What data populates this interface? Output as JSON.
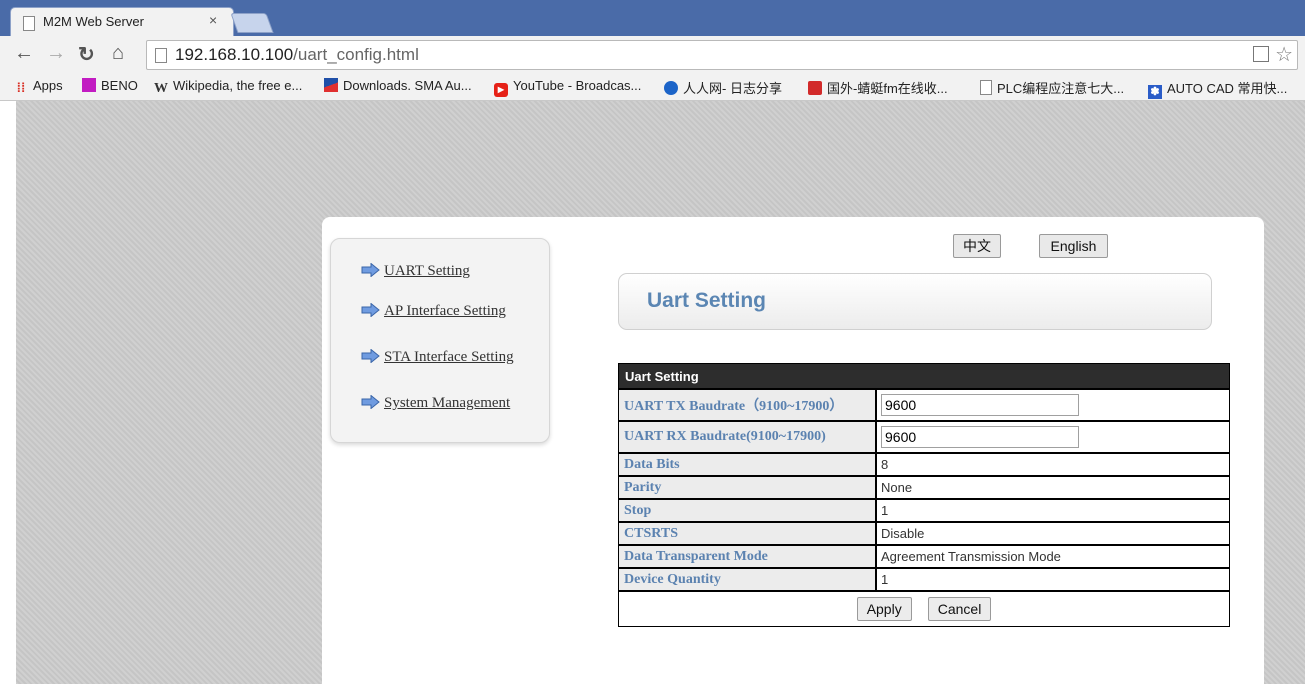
{
  "browser": {
    "tab_title": "M2M Web Server",
    "close_glyph": "×",
    "url_host": "192.168.10.100",
    "url_path": "/uart_config.html",
    "bookmarks": [
      {
        "label": "Apps",
        "icon": "apps-grid-icon",
        "color": "#d93025"
      },
      {
        "label": "BENO",
        "icon": "beno-icon",
        "color": "#c21cc2"
      },
      {
        "label": "Wikipedia, the free e...",
        "icon": "wikipedia-icon",
        "color": "#333333"
      },
      {
        "label": "Downloads. SMA Au...",
        "icon": "sma-icon",
        "color": "#1f4fa8"
      },
      {
        "label": "YouTube - Broadcas...",
        "icon": "youtube-icon",
        "color": "#e62117"
      },
      {
        "label": "人人网- 日志分享",
        "icon": "renren-icon",
        "color": "#1c64c8"
      },
      {
        "label": "国外-蜻蜓fm在线收...",
        "icon": "qingting-icon",
        "color": "#d22a2a"
      },
      {
        "label": "PLC编程应注意七大...",
        "icon": "page-icon",
        "color": "#888888"
      },
      {
        "label": "AUTO CAD 常用快...",
        "icon": "baidu-icon",
        "color": "#2a5cc8"
      }
    ]
  },
  "lang": {
    "chinese": "中文",
    "english": "English"
  },
  "sidebar": {
    "items": [
      {
        "label": "UART Setting"
      },
      {
        "label": "AP Interface Setting"
      },
      {
        "label": "STA Interface Setting"
      },
      {
        "label": "System Management"
      }
    ]
  },
  "main": {
    "heading": "Uart Setting",
    "table_header": "Uart Setting",
    "rows": [
      {
        "label": "UART TX Baudrate（9100~17900）",
        "value": "9600"
      },
      {
        "label": "UART RX Baudrate(9100~17900)",
        "value": "9600"
      },
      {
        "label": "Data Bits",
        "value": "8"
      },
      {
        "label": "Parity",
        "value": "None"
      },
      {
        "label": "Stop",
        "value": "1"
      },
      {
        "label": "CTSRTS",
        "value": "Disable"
      },
      {
        "label": "Data Transparent Mode",
        "value": "Agreement Transmission Mode"
      },
      {
        "label": "Device Quantity",
        "value": "1"
      }
    ],
    "apply_label": "Apply",
    "cancel_label": "Cancel"
  },
  "colors": {
    "accent_text": "#5b82b0",
    "tab_strip": "#4a6ba8",
    "table_header_bg": "#2d2d2d"
  }
}
